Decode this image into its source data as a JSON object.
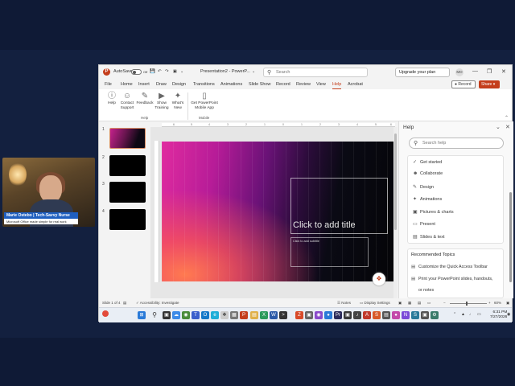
{
  "webcam": {
    "name_tag": "Marie Ostebo | Tech-Savvy Nurse",
    "subtitle": "Microsoft Office made simple for real work"
  },
  "titlebar": {
    "autosave_label": "AutoSave",
    "autosave_state": "Off",
    "document_title": "Presentation2 - PowerP...",
    "search_placeholder": "Search",
    "upgrade_label": "Upgrade your plan",
    "avatar_initials": "MO"
  },
  "menu": {
    "tabs": [
      "File",
      "Home",
      "Insert",
      "Draw",
      "Design",
      "Transitions",
      "Animations",
      "Slide Show",
      "Record",
      "Review",
      "View",
      "Help",
      "Acrobat"
    ],
    "active_tab": "Help",
    "record_label": "Record",
    "share_label": "Share"
  },
  "ribbon": {
    "buttons": [
      {
        "label": "Help",
        "icon": "question-icon"
      },
      {
        "label": "Contact Support",
        "icon": "person-headset-icon"
      },
      {
        "label": "Feedback",
        "icon": "feedback-icon"
      },
      {
        "label": "Show Training",
        "icon": "training-icon"
      },
      {
        "label": "What's New",
        "icon": "whats-new-icon"
      },
      {
        "label": "Get PowerPoint Mobile App",
        "icon": "mobile-icon"
      }
    ],
    "group_help": "Help",
    "group_mobile": "Mobile"
  },
  "ruler_marks": [
    "6",
    "5",
    "4",
    "3",
    "2",
    "1",
    "0",
    "1",
    "2",
    "3",
    "4",
    "5",
    "6"
  ],
  "thumbnails": [
    "1",
    "2",
    "3",
    "4"
  ],
  "slide": {
    "title_placeholder": "Click to add title",
    "subtitle_placeholder": "Click to add subtitle"
  },
  "help_pane": {
    "title": "Help",
    "search_placeholder": "Search help",
    "items": [
      {
        "label": "Get started",
        "icon": "check-icon"
      },
      {
        "label": "Collaborate",
        "icon": "people-icon"
      },
      {
        "label": "Design",
        "icon": "pen-icon"
      },
      {
        "label": "Animations",
        "icon": "star-icon"
      },
      {
        "label": "Pictures & charts",
        "icon": "picture-icon"
      },
      {
        "label": "Present",
        "icon": "present-icon"
      },
      {
        "label": "Slides & text",
        "icon": "slides-icon"
      }
    ],
    "recommended_title": "Recommended Topics",
    "recommended": [
      "Customize the Quick Access Toolbar",
      "Print your PowerPoint slides, handouts,",
      "or notes"
    ]
  },
  "statusbar": {
    "slide_info": "Slide 1 of 4",
    "accessibility": "Accessibility: Investigate",
    "notes": "Notes",
    "display_settings": "Display Settings",
    "zoom": "60%"
  },
  "taskbar": {
    "time": "6:31 PM",
    "date": "7/27/2026"
  },
  "colors": {
    "accent": "#c43e1c",
    "background": "#0f1a36"
  }
}
